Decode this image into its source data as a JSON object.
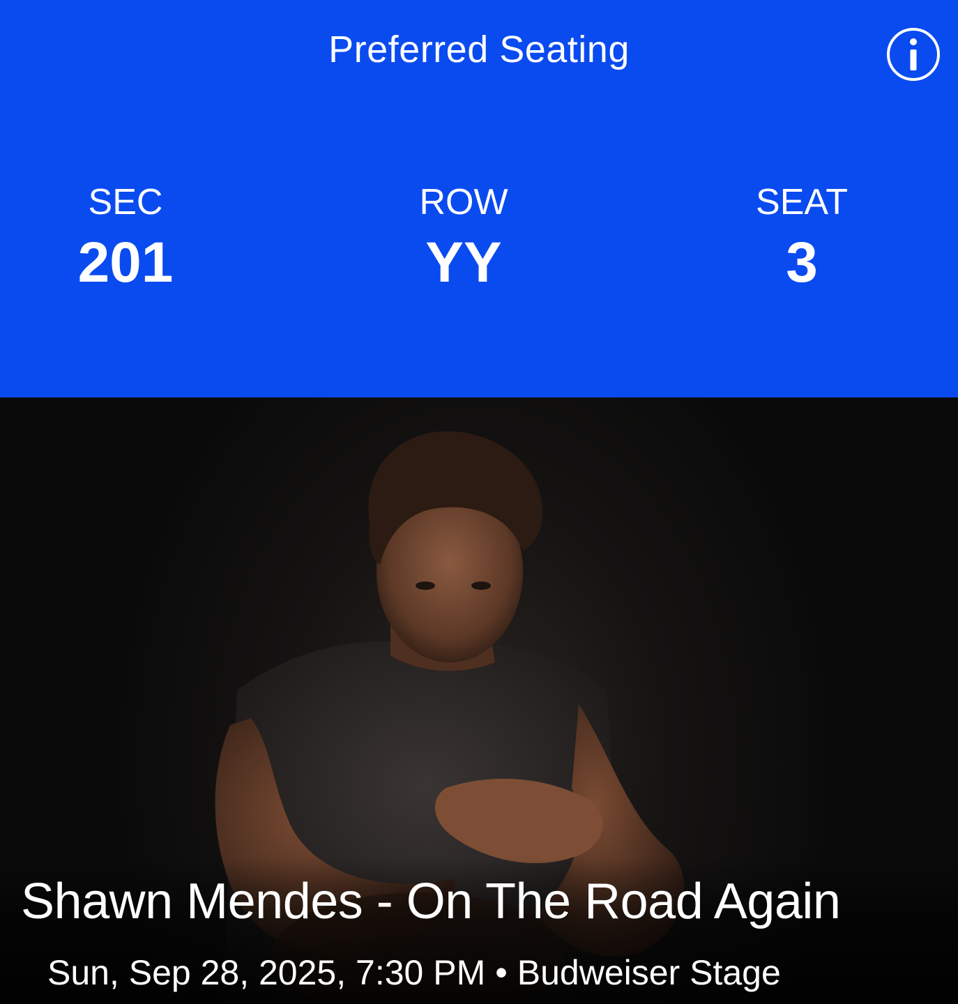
{
  "header": {
    "title": "Preferred Seating",
    "info_icon": "info-circle-icon",
    "background": "#0a4bf0"
  },
  "seat": {
    "section": {
      "label": "SEC",
      "value": "201"
    },
    "row": {
      "label": "ROW",
      "value": "YY"
    },
    "seat": {
      "label": "SEAT",
      "value": "3"
    }
  },
  "event": {
    "name": "Shawn Mendes - On The Road Again",
    "date": "Sun, Sep 28, 2025, 7:30 PM",
    "separator": "•",
    "venue": "Budweiser Stage"
  }
}
